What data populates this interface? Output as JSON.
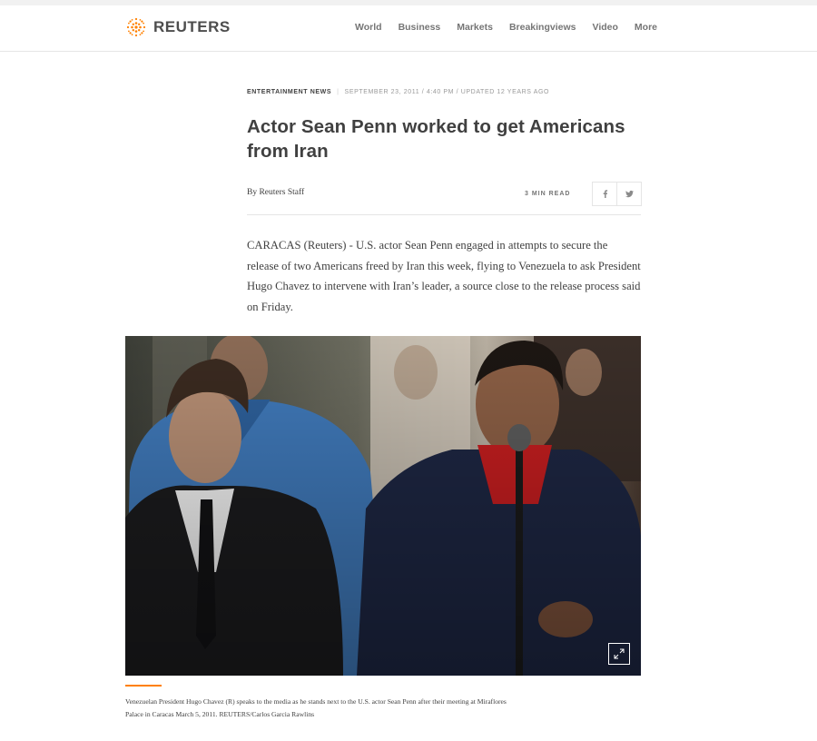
{
  "brand": {
    "name": "REUTERS",
    "accent": "#ff8000"
  },
  "nav": {
    "items": [
      "World",
      "Business",
      "Markets",
      "Breakingviews",
      "Video",
      "More"
    ]
  },
  "article": {
    "section": "ENTERTAINMENT NEWS",
    "dateline": "SEPTEMBER 23, 2011 / 4:40 PM / UPDATED 12 YEARS AGO",
    "headline": "Actor Sean Penn worked to get Americans from Iran",
    "byline_prefix": "By ",
    "author": "Reuters Staff",
    "read_time": "3 MIN READ",
    "share": [
      "facebook-icon",
      "twitter-icon"
    ],
    "body": "CARACAS (Reuters) - U.S. actor Sean Penn engaged in attempts to secure the release of two Americans freed by Iran this week, flying to Venezuela to ask President Hugo Chavez to intervene with Iran’s leader, a source close to the release process said on Friday."
  },
  "photo": {
    "caption": "Venezuelan President Hugo Chavez (R) speaks to the media as he stands next to the U.S. actor Sean Penn after their meeting at Miraflores Palace in Caracas March 5, 2011. REUTERS/Carlos Garcia Rawlins",
    "expand_icon": "expand-icon"
  }
}
